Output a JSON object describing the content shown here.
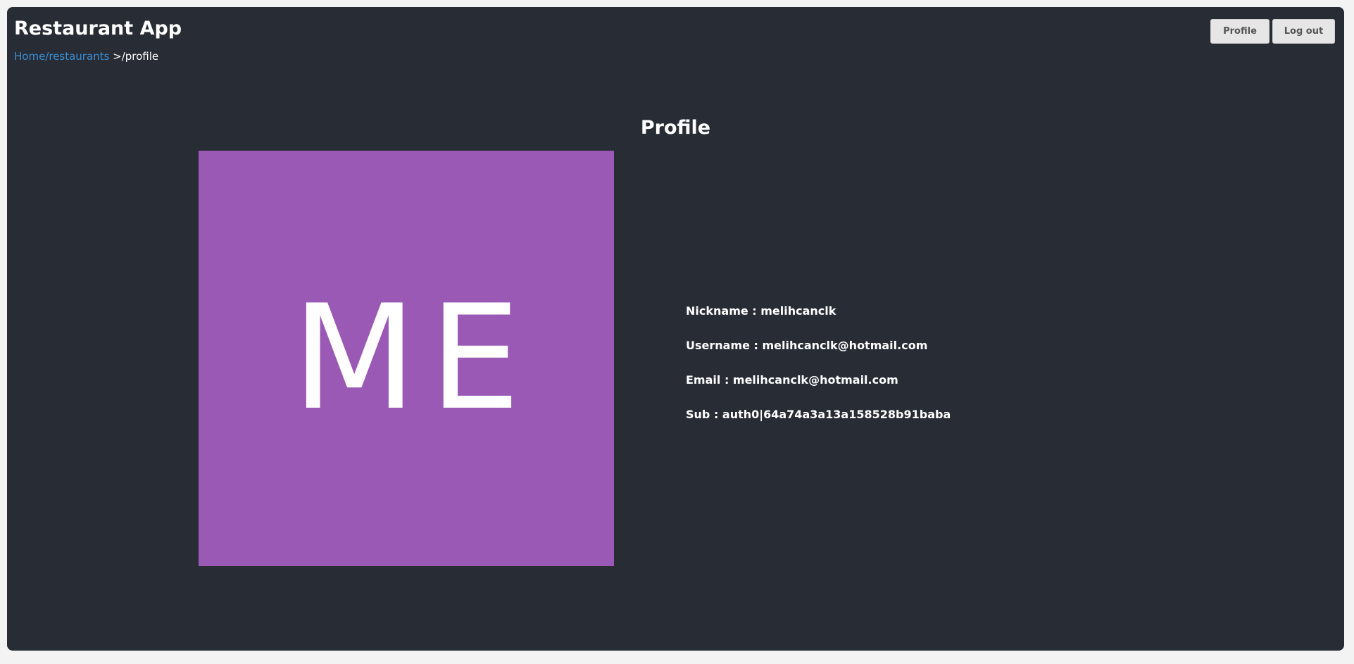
{
  "header": {
    "app_title": "Restaurant App",
    "breadcrumb": {
      "link_text": "Home/restaurants",
      "current_text": " >/profile"
    },
    "buttons": {
      "profile_label": "Profile",
      "logout_label": "Log out"
    }
  },
  "main": {
    "heading": "Profile",
    "avatar": {
      "initials": "ME",
      "background_color": "#9b59b6"
    },
    "fields": [
      {
        "text": "Nickname : melihcanclk"
      },
      {
        "text": "Username : melihcanclk@hotmail.com"
      },
      {
        "text": "Email : melihcanclk@hotmail.com"
      },
      {
        "text": "Sub : auth0|64a74a3a13a158528b91baba"
      }
    ]
  },
  "colors": {
    "page_background": "#272c35",
    "link": "#3b8fd6",
    "text": "#ffffff",
    "button_background": "#e6e6e6"
  }
}
